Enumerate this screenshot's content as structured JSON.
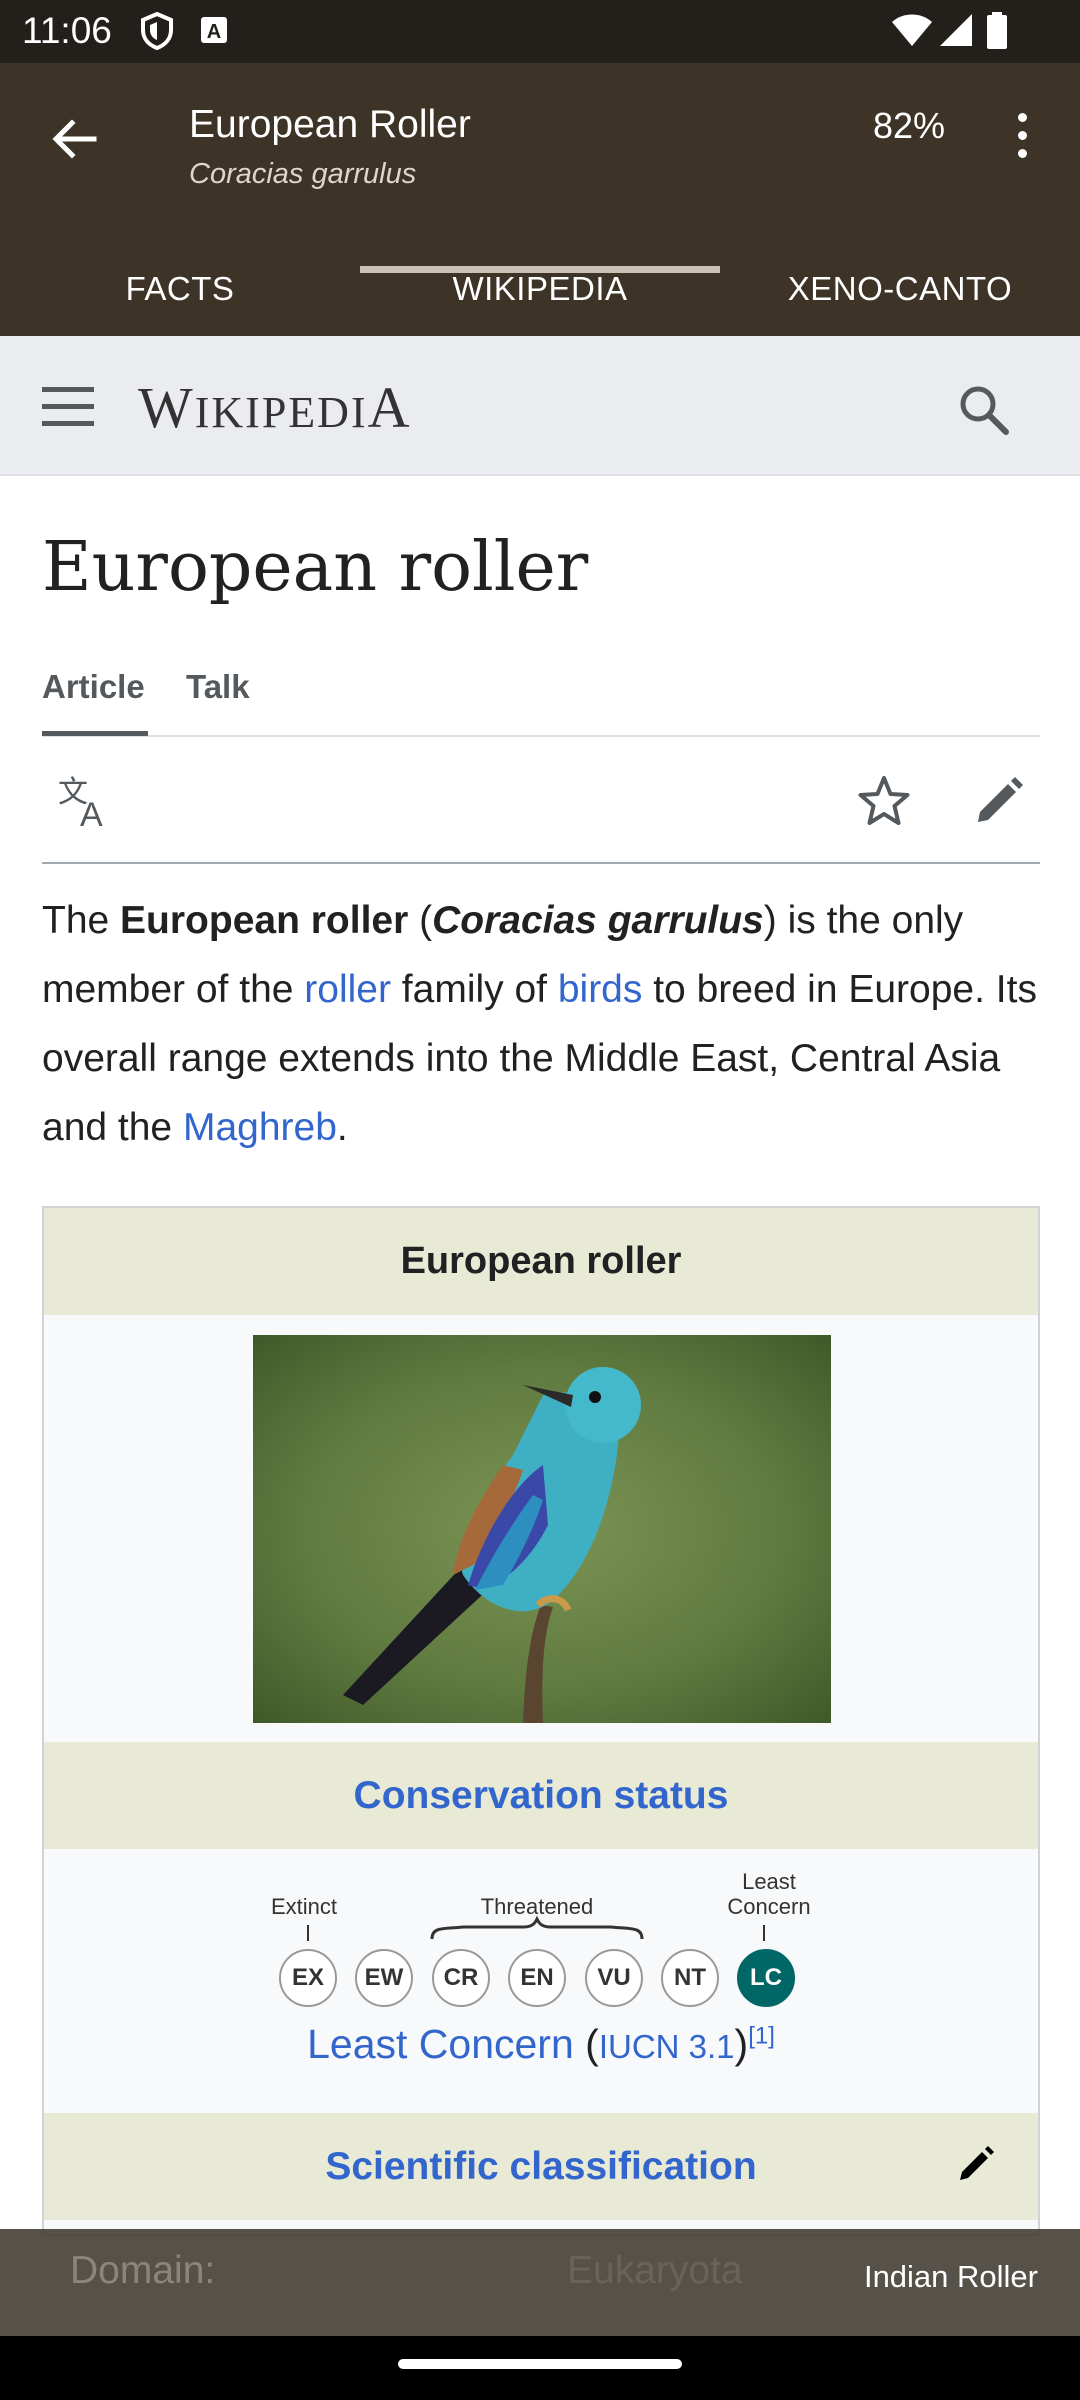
{
  "status_bar": {
    "time": "11:06"
  },
  "app_bar": {
    "title": "European Roller",
    "subtitle": "Coracias garrulus",
    "zoom": "82%"
  },
  "tabs": [
    {
      "label": "FACTS"
    },
    {
      "label": "WIKIPEDIA"
    },
    {
      "label": "XENO-CANTO"
    }
  ],
  "wiki": {
    "logo": "Wikipedia",
    "page_title": "European roller",
    "page_tabs": [
      "Article",
      "Talk"
    ],
    "lead": {
      "s1": "The ",
      "b1": "European roller",
      "s2": " (",
      "b2": "Coracias garrulus",
      "s3": ") is the only member of the ",
      "l1": "roller",
      "s4": " family of ",
      "l2": "birds",
      "s5": " to breed in Europe. Its overall range extends into the Middle East, Central Asia and the ",
      "l3": "Maghreb",
      "s6": "."
    },
    "infobox": {
      "heading": "European roller",
      "conservation_heading": "Conservation status",
      "labels": {
        "extinct": "Extinct",
        "threatened": "Threatened",
        "least": "Least",
        "concern": "Concern"
      },
      "codes": [
        "EX",
        "EW",
        "CR",
        "EN",
        "VU",
        "NT",
        "LC"
      ],
      "status": "Least Concern",
      "iucn": "IUCN 3.1",
      "ref": "[1]",
      "classification_heading": "Scientific classification"
    }
  },
  "snackbar": {
    "domain_label": "Domain:",
    "domain_value": "Eukaryota",
    "next_species": "Indian Roller"
  },
  "colors": {
    "app_bar": "#3d3427",
    "link": "#3366cc",
    "lc": "#006666"
  }
}
